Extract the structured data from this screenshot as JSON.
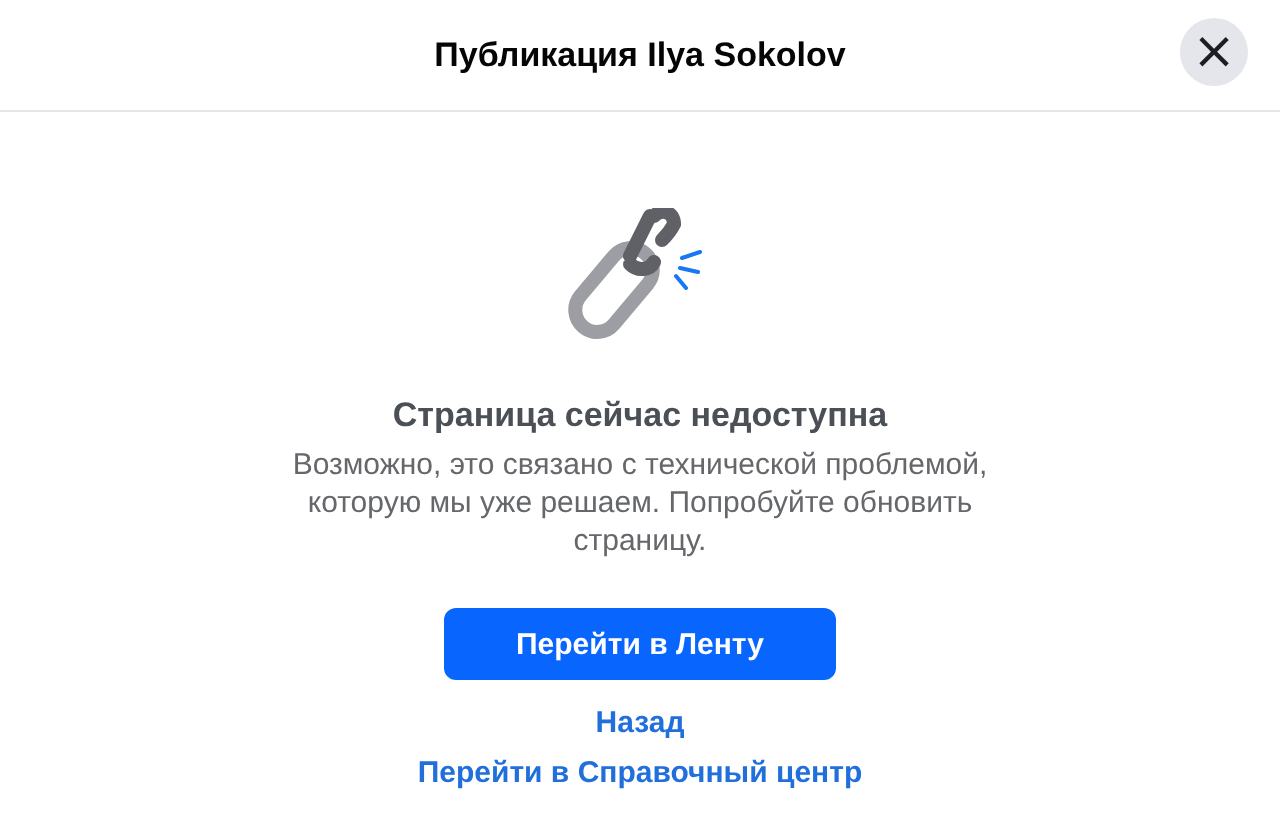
{
  "dialog": {
    "title": "Публикация Ilya Sokolov",
    "close": "×"
  },
  "message": {
    "heading": "Страница сейчас недоступна",
    "body": "Возможно, это связано с технической проблемой, которую мы уже решаем. Попробуйте обновить страницу."
  },
  "primary_button": "Перейти в Ленту",
  "links": [
    "Назад",
    "Перейти в Справочный центр"
  ]
}
